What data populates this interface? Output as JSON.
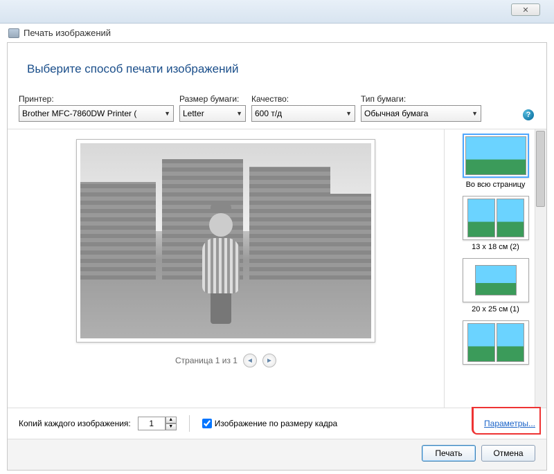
{
  "titlebar": {
    "close_glyph": "✕"
  },
  "window_title": "Печать изображений",
  "instruction": "Выберите способ печати изображений",
  "options": {
    "printer_label": "Принтер:",
    "printer_value": "Brother MFC-7860DW Printer ( ",
    "paper_label": "Размер бумаги:",
    "paper_value": "Letter",
    "quality_label": "Качество:",
    "quality_value": "600 т/д",
    "ptype_label": "Тип бумаги:",
    "ptype_value": "Обычная бумага",
    "help_glyph": "?"
  },
  "pager": {
    "label": "Страница 1 из 1",
    "prev": "◄",
    "next": "►"
  },
  "layouts": [
    {
      "label": "Во всю страницу"
    },
    {
      "label": "13 x 18 см (2)"
    },
    {
      "label": "20 x 25 см (1)"
    },
    {
      "label": ""
    }
  ],
  "bottom": {
    "copies_label": "Копий каждого изображения:",
    "copies_value": "1",
    "fit_label": "Изображение по размеру кадра",
    "params_link": "Параметры..."
  },
  "actions": {
    "print": "Печать",
    "cancel": "Отмена"
  }
}
